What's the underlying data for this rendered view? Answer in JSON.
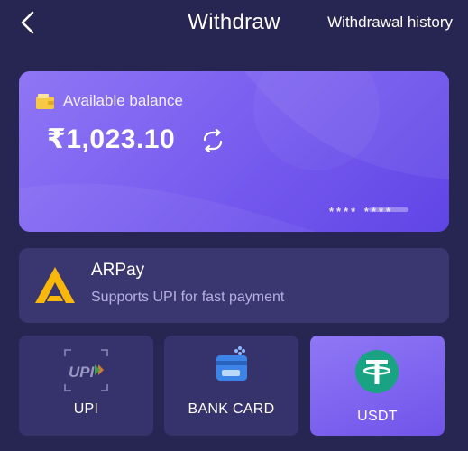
{
  "header": {
    "title": "Withdraw",
    "history_label": "Withdrawal history"
  },
  "balance_card": {
    "label": "Available balance",
    "amount": "₹1,023.10",
    "card_mask": "****  ****"
  },
  "payment_method": {
    "name": "ARPay",
    "description": "Supports UPI for fast payment"
  },
  "channels": [
    {
      "label": "UPI",
      "icon": "upi-icon",
      "selected": false
    },
    {
      "label": "BANK CARD",
      "icon": "bank-card-icon",
      "selected": false
    },
    {
      "label": "USDT",
      "icon": "tether-icon",
      "selected": true
    }
  ],
  "colors": {
    "background": "#272551",
    "accent": "#7a5ff0",
    "arpay_logo": "#f8b70a",
    "tether": "#1aa382",
    "bank_icon": "#3d84e8"
  }
}
